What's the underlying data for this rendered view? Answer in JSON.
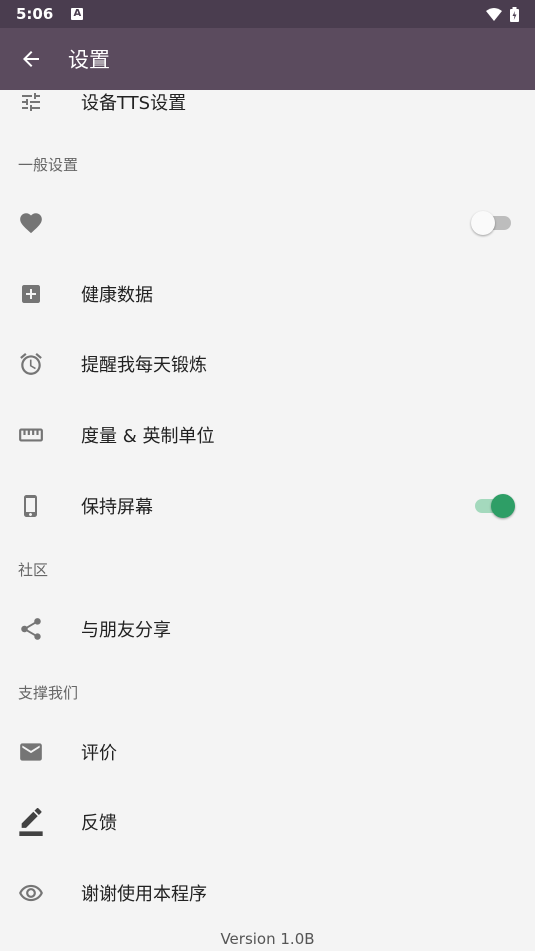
{
  "status_bar": {
    "time": "5:06",
    "notification_badge": "A"
  },
  "app_bar": {
    "title": "设置"
  },
  "items": {
    "tts": {
      "label": "设备TTS设置"
    },
    "heart": {
      "label": "",
      "switch_on": false
    },
    "health": {
      "label": "健康数据"
    },
    "reminder": {
      "label": "提醒我每天锻炼"
    },
    "units": {
      "label": "度量 & 英制单位"
    },
    "screen": {
      "label": "保持屏幕",
      "switch_on": true
    },
    "share": {
      "label": "与朋友分享"
    },
    "rate": {
      "label": "评价"
    },
    "feedback": {
      "label": "反馈"
    },
    "thanks": {
      "label": "谢谢使用本程序"
    }
  },
  "sections": {
    "general": "一般设置",
    "community": "社区",
    "support": "支撑我们"
  },
  "version": "Version 1.0B",
  "colors": {
    "status_bar": "#4a3d4f",
    "app_bar": "#5b4b5e",
    "background": "#f4f4f4",
    "switch_on": "#2e9e66",
    "icon": "#757575"
  }
}
